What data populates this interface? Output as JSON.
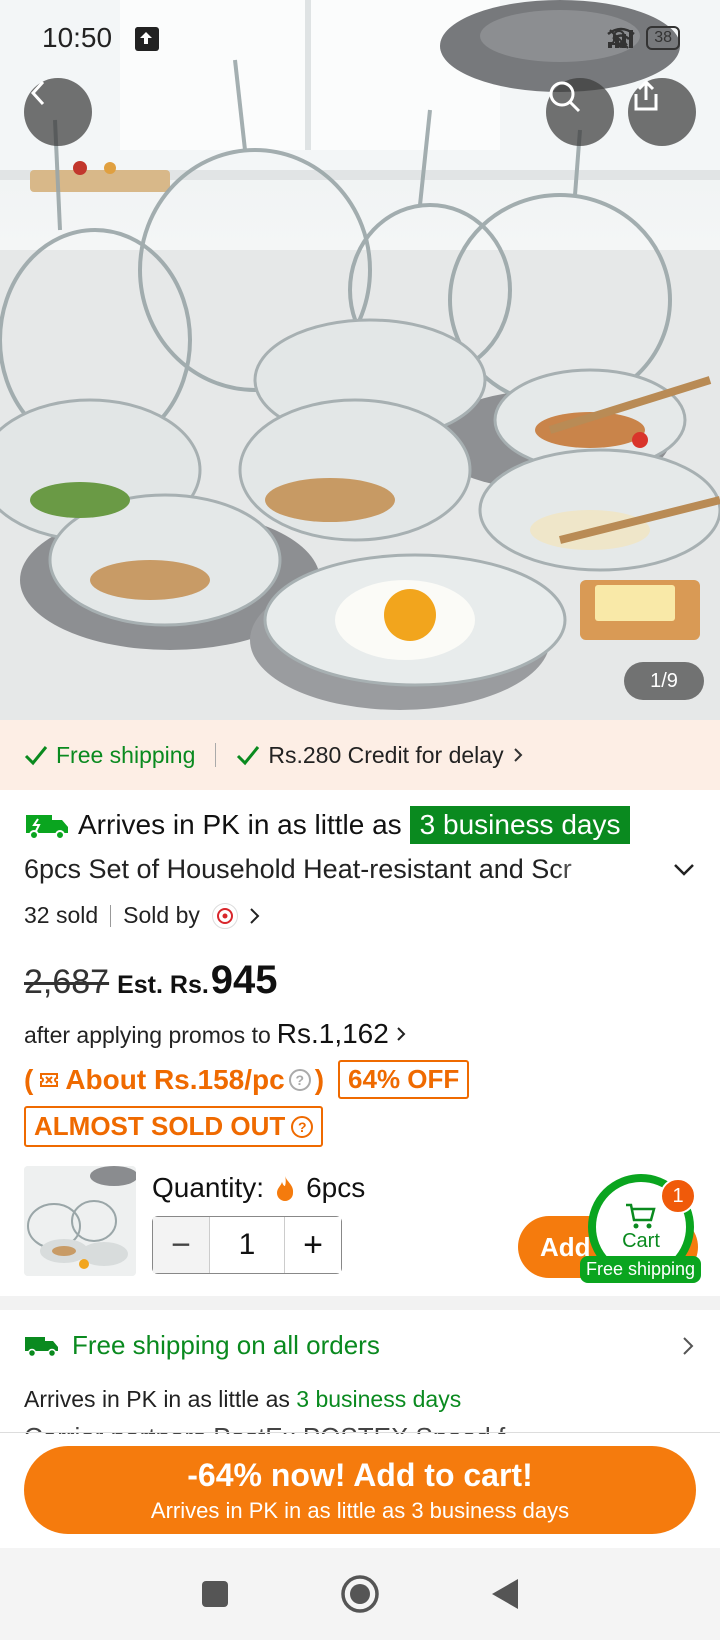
{
  "status_bar": {
    "time": "10:50",
    "battery": "38"
  },
  "gallery": {
    "counter": "1/9"
  },
  "shipping_bar": {
    "free_shipping": "Free shipping",
    "credit": "Rs.280 Credit for delay"
  },
  "product": {
    "arrive_prefix": "Arrives in PK in as little as",
    "arrive_badge": "3 business days",
    "title": "6pcs Set of Household Heat-resistant and Scr",
    "sold": "32 sold",
    "sold_by": "Sold by"
  },
  "price": {
    "old": "2,687",
    "est_label": "Est. Rs.",
    "new": "945",
    "promo_text": "after applying promos to",
    "promo_amount": "Rs.1,162",
    "per_pc": "About Rs.158/pc",
    "per_pc_open": "(",
    "per_pc_close": ")",
    "off": "64% OFF",
    "almost": "ALMOST SOLD OUT"
  },
  "quantity": {
    "label": "Quantity:",
    "pcs": "6pcs",
    "value": "1",
    "minus": "−",
    "plus": "+"
  },
  "add_button": {
    "label": "Add"
  },
  "cart": {
    "label": "Cart",
    "count": "1",
    "free_shipping": "Free shipping"
  },
  "shipping_info": {
    "free_all": "Free shipping on all orders",
    "arrive_prefix": "Arrives in PK in as little as",
    "arrive_days": "3 business days",
    "cut_text": "Carrier partners  PostEx  POSTEX  Speed f"
  },
  "cta": {
    "line1": "-64% now! Add to cart!",
    "line2": "Arrives in PK in as little as 3 business days"
  },
  "colors": {
    "accent": "#f57b0d",
    "green": "#0a8a1f",
    "ship_bar_bg": "#fdeee5"
  }
}
